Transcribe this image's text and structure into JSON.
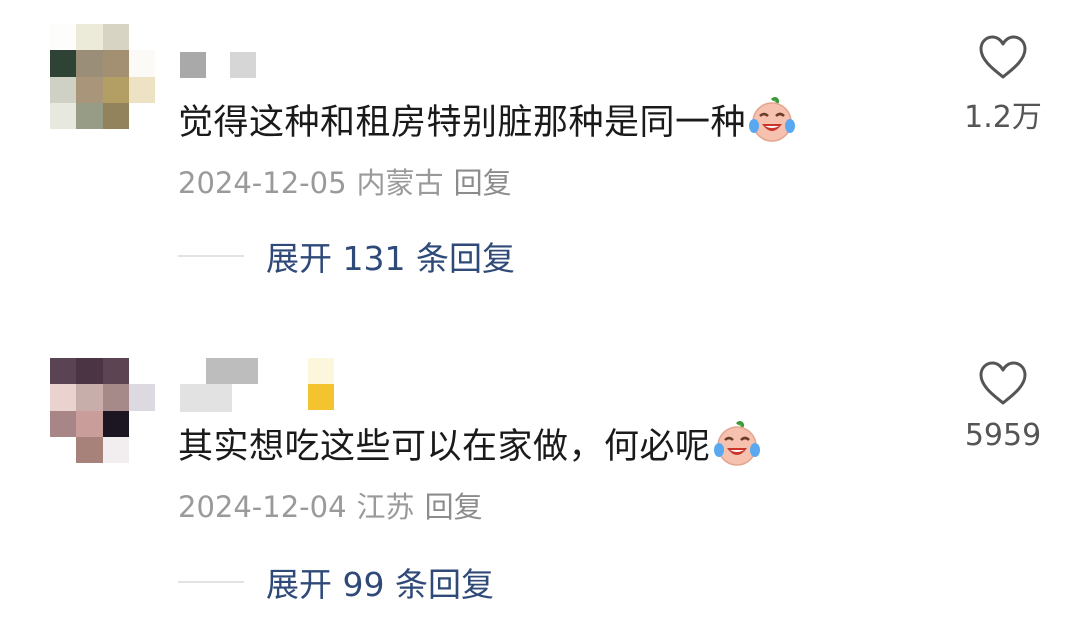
{
  "comments": [
    {
      "text": "觉得这种和租房特别脏那种是同一种",
      "emoji": "laughing-crying-emoji",
      "date": "2024-12-05",
      "location": "内蒙古",
      "reply_label": "回复",
      "expand_label": "展开 131 条回复",
      "likes": "1.2万"
    },
    {
      "text": "其实想吃这些可以在家做，何必呢",
      "emoji": "laughing-crying-emoji",
      "date": "2024-12-04",
      "location": "江苏",
      "reply_label": "回复",
      "expand_label": "展开 99 条回复",
      "likes": "5959"
    }
  ],
  "icons": {
    "like": "heart-outline-icon"
  },
  "colors": {
    "link": "#2f4a78",
    "meta": "#9a9a9a",
    "text": "#1a1a1a"
  }
}
